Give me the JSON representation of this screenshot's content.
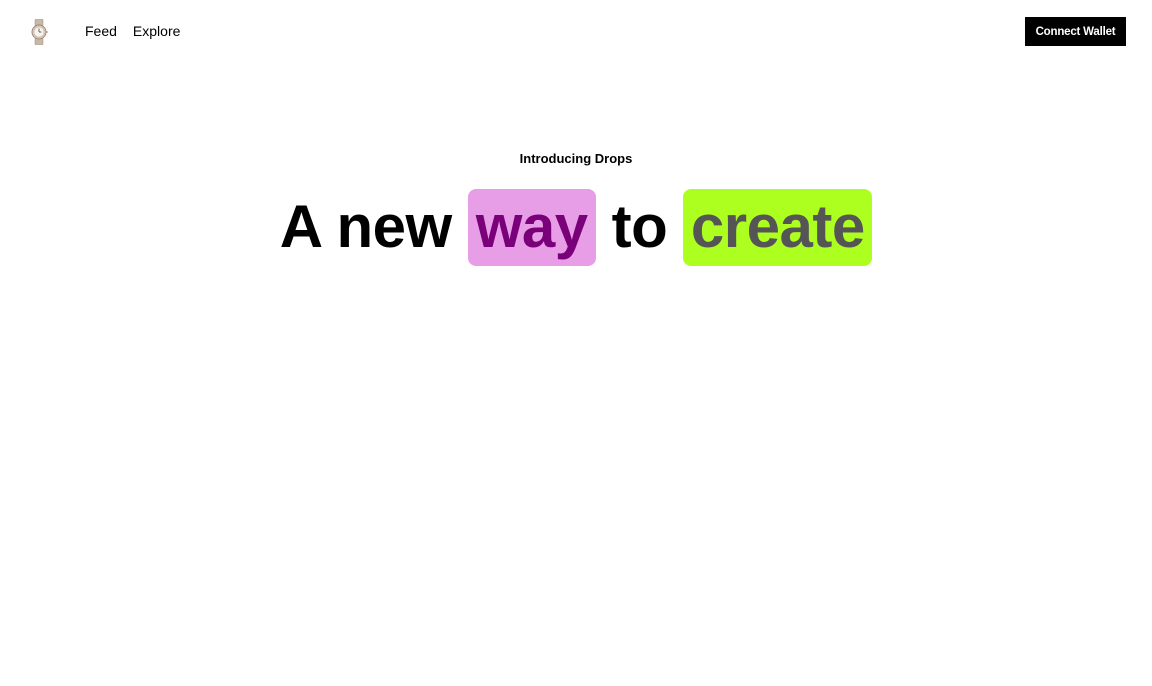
{
  "header": {
    "logo_icon": "wristwatch-icon",
    "nav": [
      {
        "label": "Feed"
      },
      {
        "label": "Explore"
      }
    ],
    "connect_label": "Connect Wallet"
  },
  "hero": {
    "eyebrow": "Introducing Drops",
    "headline": {
      "part1": "A new",
      "highlight1": "way",
      "part2": "to",
      "highlight2": "create"
    }
  },
  "colors": {
    "highlight1_bg": "#e89ee7",
    "highlight1_text": "#7a007a",
    "highlight2_bg": "#adff1f",
    "highlight2_text": "#555555",
    "button_bg": "#000000",
    "button_text": "#ffffff"
  }
}
